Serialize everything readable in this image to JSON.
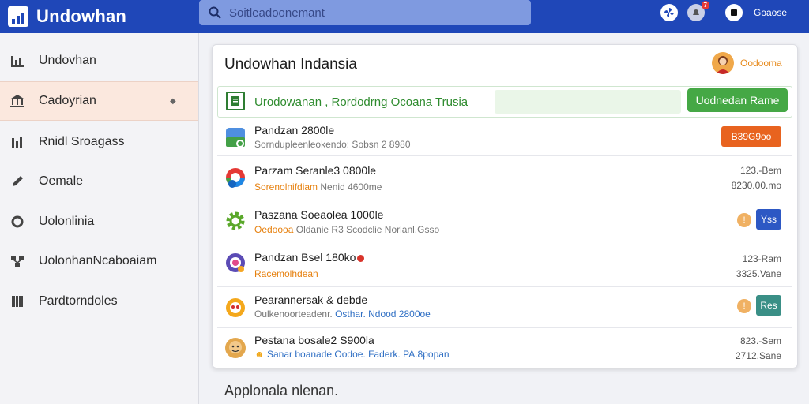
{
  "app": {
    "title": "Undowhan"
  },
  "search": {
    "placeholder": "Soitleadoonemant"
  },
  "topbar": {
    "notification_count": "7",
    "user_label": "Goaose"
  },
  "sidebar": {
    "items": [
      {
        "label": "Undovhan",
        "icon": "bar-chart-icon"
      },
      {
        "label": "Cadoyrian",
        "icon": "bank-icon",
        "active": true
      },
      {
        "label": "Rnidl Sroagass",
        "icon": "chart-icon"
      },
      {
        "label": "Oemale",
        "icon": "pencil-icon"
      },
      {
        "label": "Uolonlinia",
        "icon": "circle-icon"
      },
      {
        "label": "UolonhanNcaboaiam",
        "icon": "network-icon"
      },
      {
        "label": "Pardtorndoles",
        "icon": "book-icon"
      }
    ]
  },
  "card": {
    "title": "Undowhan Indansia",
    "user_name": "Oodooma",
    "status_text": "Urodowanan , Rordodrng Ocoana Trusia",
    "status_button": "Uodnedan Rame",
    "items": [
      {
        "title": "Pandzan 2800le",
        "sub": "Sorndupleenleokendo: Sobsn 2 8980",
        "button": "B39G9oo",
        "button_color": "#e8631f"
      },
      {
        "title": "Parzam Seranle3 0800le",
        "sub_hl": "Sorenolnifdiam",
        "sub": "Nenid 4600me",
        "meta1": "123.-Bem",
        "meta2": "8230.00.mo"
      },
      {
        "title": "Paszana Soeaolea 1000le",
        "sub_hl": "Oedoooa",
        "sub": "Oldanie R3 Scodclie Norlanl.Gsso",
        "button": "Yss",
        "button_color": "#2d58c4"
      },
      {
        "title": "Pandzan Bsel 180ko",
        "sub_hl": "Racemolhdean",
        "meta1": "123-Ram",
        "meta2": "3325.Vane"
      },
      {
        "title": "Pearannersak & debde",
        "sub": "Oulkenoorteadenr.",
        "sub_bl": "Osthar. Ndood 2800oe",
        "button": "Res",
        "button_color": "#3a8f86"
      },
      {
        "title": "Pestana bosale2 S900la",
        "sub_bl": "Sanar boanade Oodoe. Faderk. PA.8popan",
        "meta1": "823.-Sem",
        "meta2": "2712.Sane"
      }
    ]
  },
  "footer": {
    "text": "Applonala nlenan."
  },
  "colors": {
    "primary": "#1f47b8",
    "accent_green": "#45a845",
    "accent_orange": "#e8631f",
    "accent_blue": "#2d58c4"
  }
}
